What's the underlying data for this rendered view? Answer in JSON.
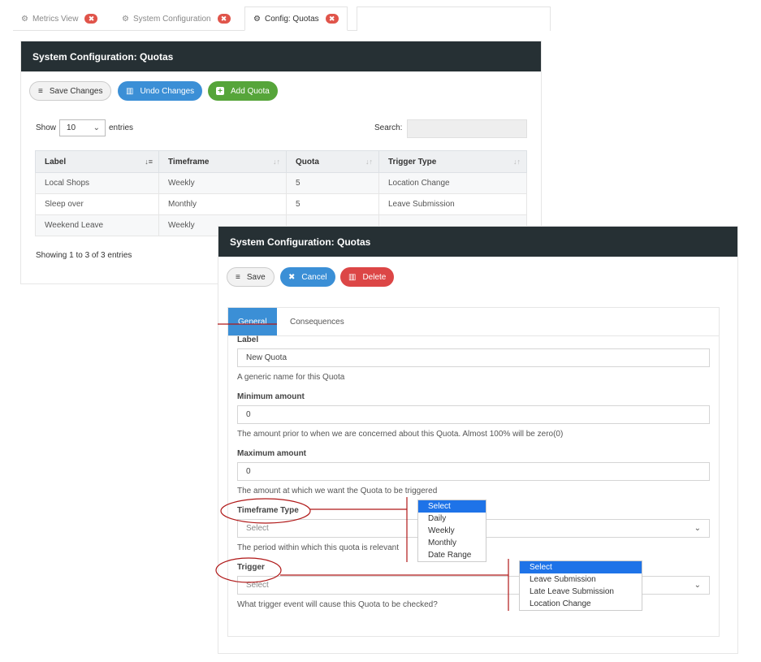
{
  "tabs": [
    {
      "icon": "⚙",
      "label": "Metrics View",
      "close": "✖"
    },
    {
      "icon": "⚙",
      "label": "System Configuration",
      "close": "✖"
    },
    {
      "icon": "⚙",
      "label": "Config: Quotas",
      "close": "✖"
    }
  ],
  "list_panel": {
    "title": "System Configuration: Quotas",
    "buttons": {
      "save": "Save Changes",
      "undo": "Undo Changes",
      "add": "Add Quota"
    },
    "show_label": "Show",
    "entries_value": "10",
    "entries_label": "entries",
    "search_label": "Search:",
    "columns": [
      "Label",
      "Timeframe",
      "Quota",
      "Trigger Type"
    ],
    "rows": [
      [
        "Local Shops",
        "Weekly",
        "5",
        "Location Change"
      ],
      [
        "Sleep over",
        "Monthly",
        "5",
        "Leave Submission"
      ],
      [
        "Weekend Leave",
        "Weekly",
        "",
        ""
      ]
    ],
    "info": "Showing 1 to 3 of 3 entries"
  },
  "form_panel": {
    "title": "System Configuration: Quotas",
    "buttons": {
      "save": "Save",
      "cancel": "Cancel",
      "delete": "Delete"
    },
    "tabs": {
      "general": "General",
      "consequences": "Consequences"
    },
    "fields": {
      "label": {
        "label": "Label",
        "value": "New Quota",
        "help": "A generic name for this Quota"
      },
      "minimum": {
        "label": "Minimum amount",
        "value": "0",
        "help": "The amount prior to when we are concerned about this Quota. Almost 100% will be zero(0)"
      },
      "maximum": {
        "label": "Maximum amount",
        "value": "0",
        "help": "The amount at which we want the Quota to be triggered"
      },
      "timeframe": {
        "label": "Timeframe Type",
        "value": "Select",
        "help": "The period within which this quota is relevant"
      },
      "trigger": {
        "label": "Trigger",
        "value": "Select",
        "help": "What trigger event will cause this Quota to be checked?"
      }
    }
  },
  "timeframe_options": [
    "Select",
    "Daily",
    "Weekly",
    "Monthly",
    "Date Range"
  ],
  "trigger_options": [
    "Select",
    "Leave Submission",
    "Late Leave Submission",
    "Location Change"
  ],
  "colors": {
    "header": "#263034",
    "blue": "#3b8fd6",
    "green": "#56a53a",
    "red": "#dc4646",
    "annotation": "#b01818",
    "option_selected": "#1e73e8"
  }
}
